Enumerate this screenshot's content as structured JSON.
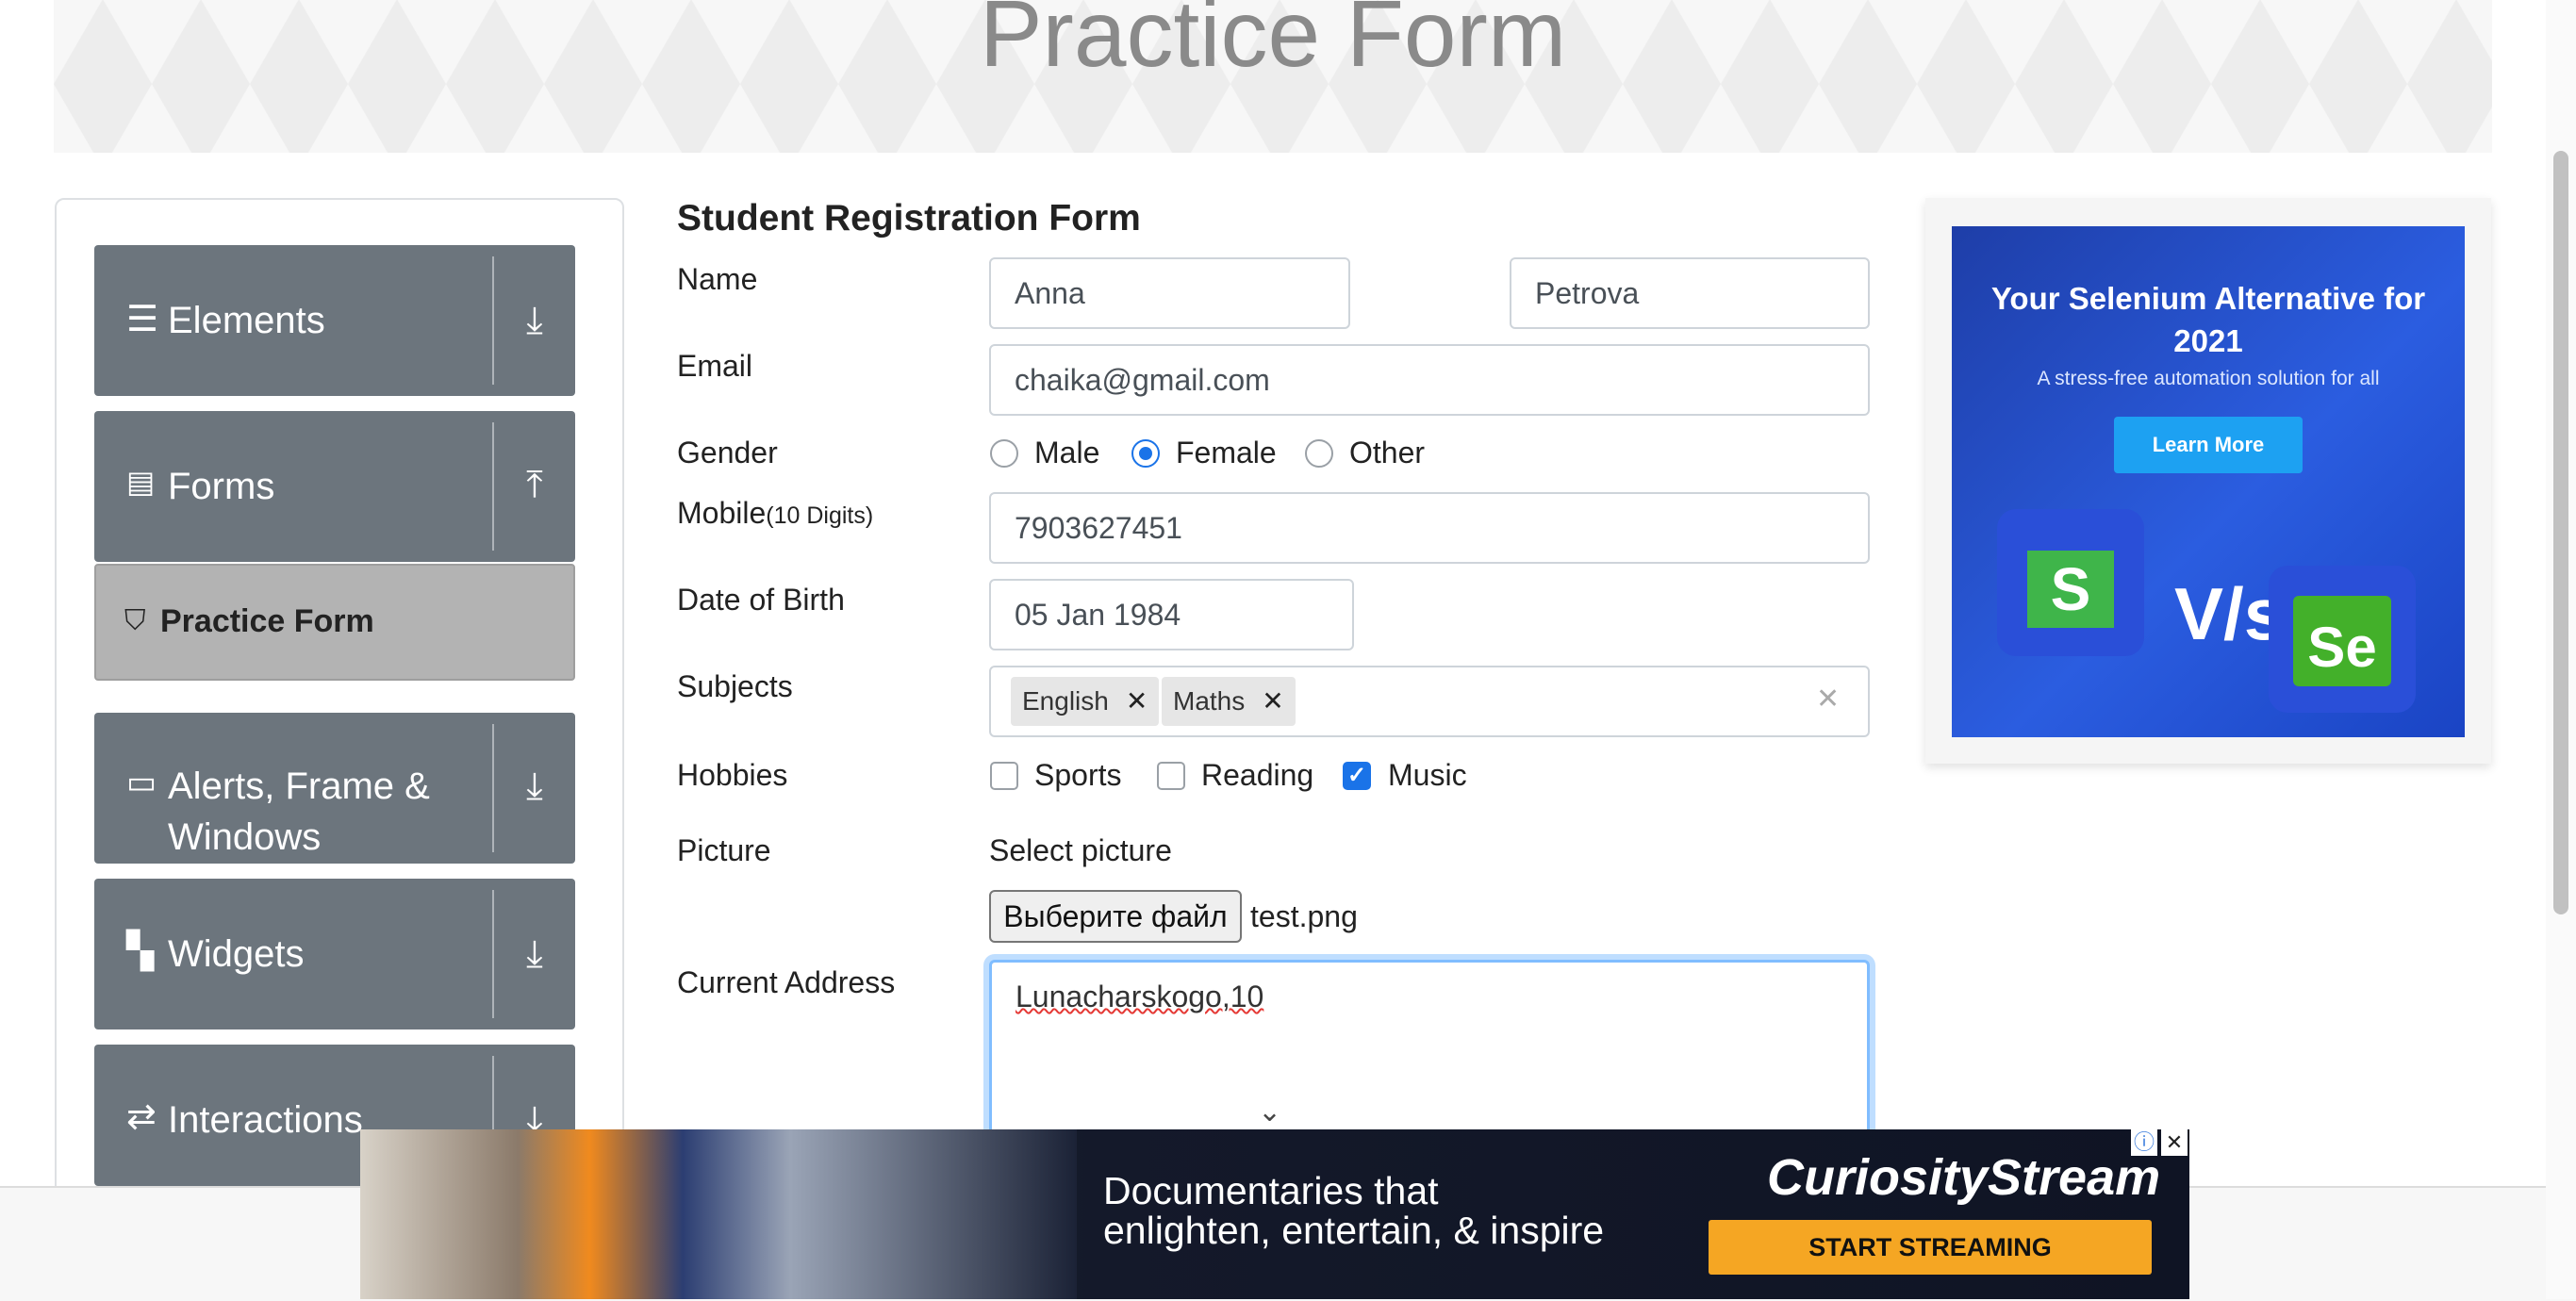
{
  "banner": {
    "title": "Practice Form"
  },
  "sidebar": {
    "groups": [
      {
        "label": "Elements",
        "icon": "hamburger-icon",
        "arrow": "download-arrow-icon"
      },
      {
        "label": "Forms",
        "icon": "document-icon",
        "arrow": "upload-arrow-icon"
      },
      {
        "label": "Alerts, Frame &",
        "label2": "Windows",
        "icon": "window-icon",
        "arrow": "download-arrow-icon"
      },
      {
        "label": "Widgets",
        "icon": "widgets-icon",
        "arrow": "download-arrow-icon"
      },
      {
        "label": "Interactions",
        "icon": "interactions-icon",
        "arrow": "download-arrow-icon"
      }
    ],
    "active_item": "Practice Form"
  },
  "form": {
    "title": "Student Registration Form",
    "name_label": "Name",
    "first_name": "Anna",
    "last_name": "Petrova",
    "email_label": "Email",
    "email": "chaika@gmail.com",
    "gender_label": "Gender",
    "genders": [
      "Male",
      "Female",
      "Other"
    ],
    "gender_selected": "Female",
    "mobile_label": "Mobile",
    "mobile_hint": "(10 Digits)",
    "mobile": "7903627451",
    "dob_label": "Date of Birth",
    "dob": "05 Jan 1984",
    "subjects_label": "Subjects",
    "subjects": [
      "English",
      "Maths"
    ],
    "hobbies_label": "Hobbies",
    "hobbies": [
      "Sports",
      "Reading",
      "Music"
    ],
    "hobbies_checked": [
      "Music"
    ],
    "picture_label": "Picture",
    "select_picture": "Select picture",
    "file_button": "Выберите файл",
    "file_name": "test.png",
    "address_label": "Current Address",
    "address": "Lunacharskogo,10"
  },
  "ad_right": {
    "headline": "Your Selenium Alternative for 2021",
    "sub": "A stress-free automation solution for all",
    "button": "Learn More",
    "logo_left": "S",
    "vs": "V/s",
    "logo_right": "Se"
  },
  "ad_bottom": {
    "text_line1": "Documentaries that",
    "text_line2": "enlighten, entertain, & inspire",
    "brand": "CuriosityStream",
    "cta": "START STREAMING"
  },
  "colors": {
    "sidebar": "#6c757d",
    "active": "#b3b3b3",
    "accent": "#1a73e8"
  }
}
